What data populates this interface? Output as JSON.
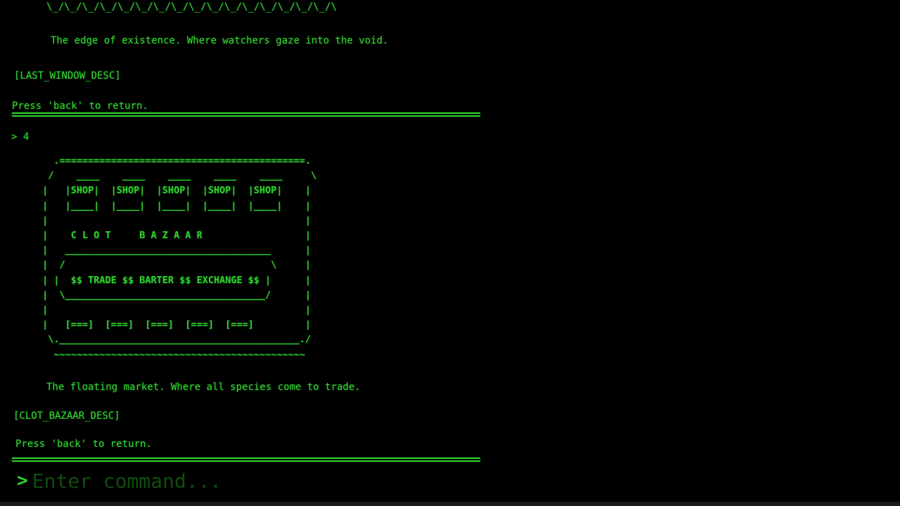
{
  "terminal": {
    "top_border_art": "\\_/\\_/\\_/\\_/\\_/\\_/\\_/\\_/\\_/\\_/\\_/\\_/\\_/\\_/\\_/\\_/\\",
    "window_tagline": "The edge of existence. Where watchers gaze into the void.",
    "window_desc_token": "[LAST_WINDOW_DESC]",
    "back_hint_1": "Press 'back' to return.",
    "user_command": "> 4",
    "bazaar_art": "   .===========================================.\n  /    ____    ____    ____    ____    ____     \\\n |   |SHOP|  |SHOP|  |SHOP|  |SHOP|  |SHOP|    |\n |   |____|  |____|  |____|  |____|  |____|    |\n |                                             |\n |    C L O T     B A Z A A R                  |\n |   ____________________________________      |\n |  /                                    \\     |\n | |  $$ TRADE $$ BARTER $$ EXCHANGE $$ |      |\n |  \\___________________________________/      |\n |                                             |\n |   [===]  [===]  [===]  [===]  [===]         |\n  \\.__________________________________________./\n   ~~~~~~~~~~~~~~~~~~~~~~~~~~~~~~~~~~~~~~~~~~~~",
    "bazaar_tagline": "The floating market. Where all species come to trade.",
    "bazaar_desc_token": "[CLOT_BAZAAR_DESC]",
    "back_hint_2": "Press 'back' to return."
  },
  "command_input": {
    "prompt_symbol": ">",
    "placeholder": "Enter command...",
    "value": ""
  },
  "colors": {
    "background": "#000000",
    "terminal_green": "#2fd12f",
    "placeholder_green": "#0f4d0f"
  }
}
